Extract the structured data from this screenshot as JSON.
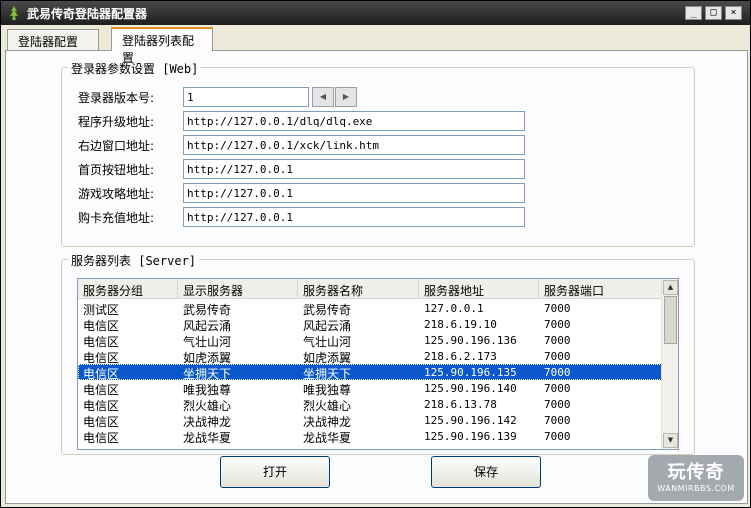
{
  "window": {
    "title": "武易传奇登陆器配置器",
    "controls": {
      "minimize": "_",
      "maximize": "□",
      "close": "×"
    }
  },
  "tabs": [
    {
      "label": "登陆器配置",
      "active": false
    },
    {
      "label": "登陆器列表配置",
      "active": true
    }
  ],
  "launcher_group": {
    "legend": "登录器参数设置 [Web]",
    "fields": [
      {
        "label": "登录器版本号:",
        "value": "1"
      },
      {
        "label": "程序升级地址:",
        "value": "http://127.0.0.1/dlq/dlq.exe"
      },
      {
        "label": "右边窗口地址:",
        "value": "http://127.0.0.1/xck/link.htm"
      },
      {
        "label": "首页按钮地址:",
        "value": "http://127.0.0.1"
      },
      {
        "label": "游戏攻略地址:",
        "value": "http://127.0.0.1"
      },
      {
        "label": "购卡充值地址:",
        "value": "http://127.0.0.1"
      }
    ],
    "spinner": {
      "left": "◀",
      "right": "▶"
    }
  },
  "server_group": {
    "legend": "服务器列表 [Server]",
    "columns": [
      "服务器分组",
      "显示服务器",
      "服务器名称",
      "服务器地址",
      "服务器端口"
    ],
    "rows": [
      [
        "测试区",
        "武易传奇",
        "武易传奇",
        "127.0.0.1",
        "7000"
      ],
      [
        "电信区",
        "风起云涌",
        "风起云涌",
        "218.6.19.10",
        "7000"
      ],
      [
        "电信区",
        "气壮山河",
        "气壮山河",
        "125.90.196.136",
        "7000"
      ],
      [
        "电信区",
        "如虎添翼",
        "如虎添翼",
        "218.6.2.173",
        "7000"
      ],
      [
        "电信区",
        "坐拥天下",
        "坐拥天下",
        "125.90.196.135",
        "7000"
      ],
      [
        "电信区",
        "唯我独尊",
        "唯我独尊",
        "125.90.196.140",
        "7000"
      ],
      [
        "电信区",
        "烈火雄心",
        "烈火雄心",
        "218.6.13.78",
        "7000"
      ],
      [
        "电信区",
        "决战神龙",
        "决战神龙",
        "125.90.196.142",
        "7000"
      ],
      [
        "电信区",
        "龙战华夏",
        "龙战华夏",
        "125.90.196.139",
        "7000"
      ]
    ],
    "selected_row": 4
  },
  "buttons": {
    "open": "打开",
    "save": "保存"
  },
  "watermark": {
    "main": "玩传奇",
    "sub": "WANMIRBBS.COM"
  }
}
